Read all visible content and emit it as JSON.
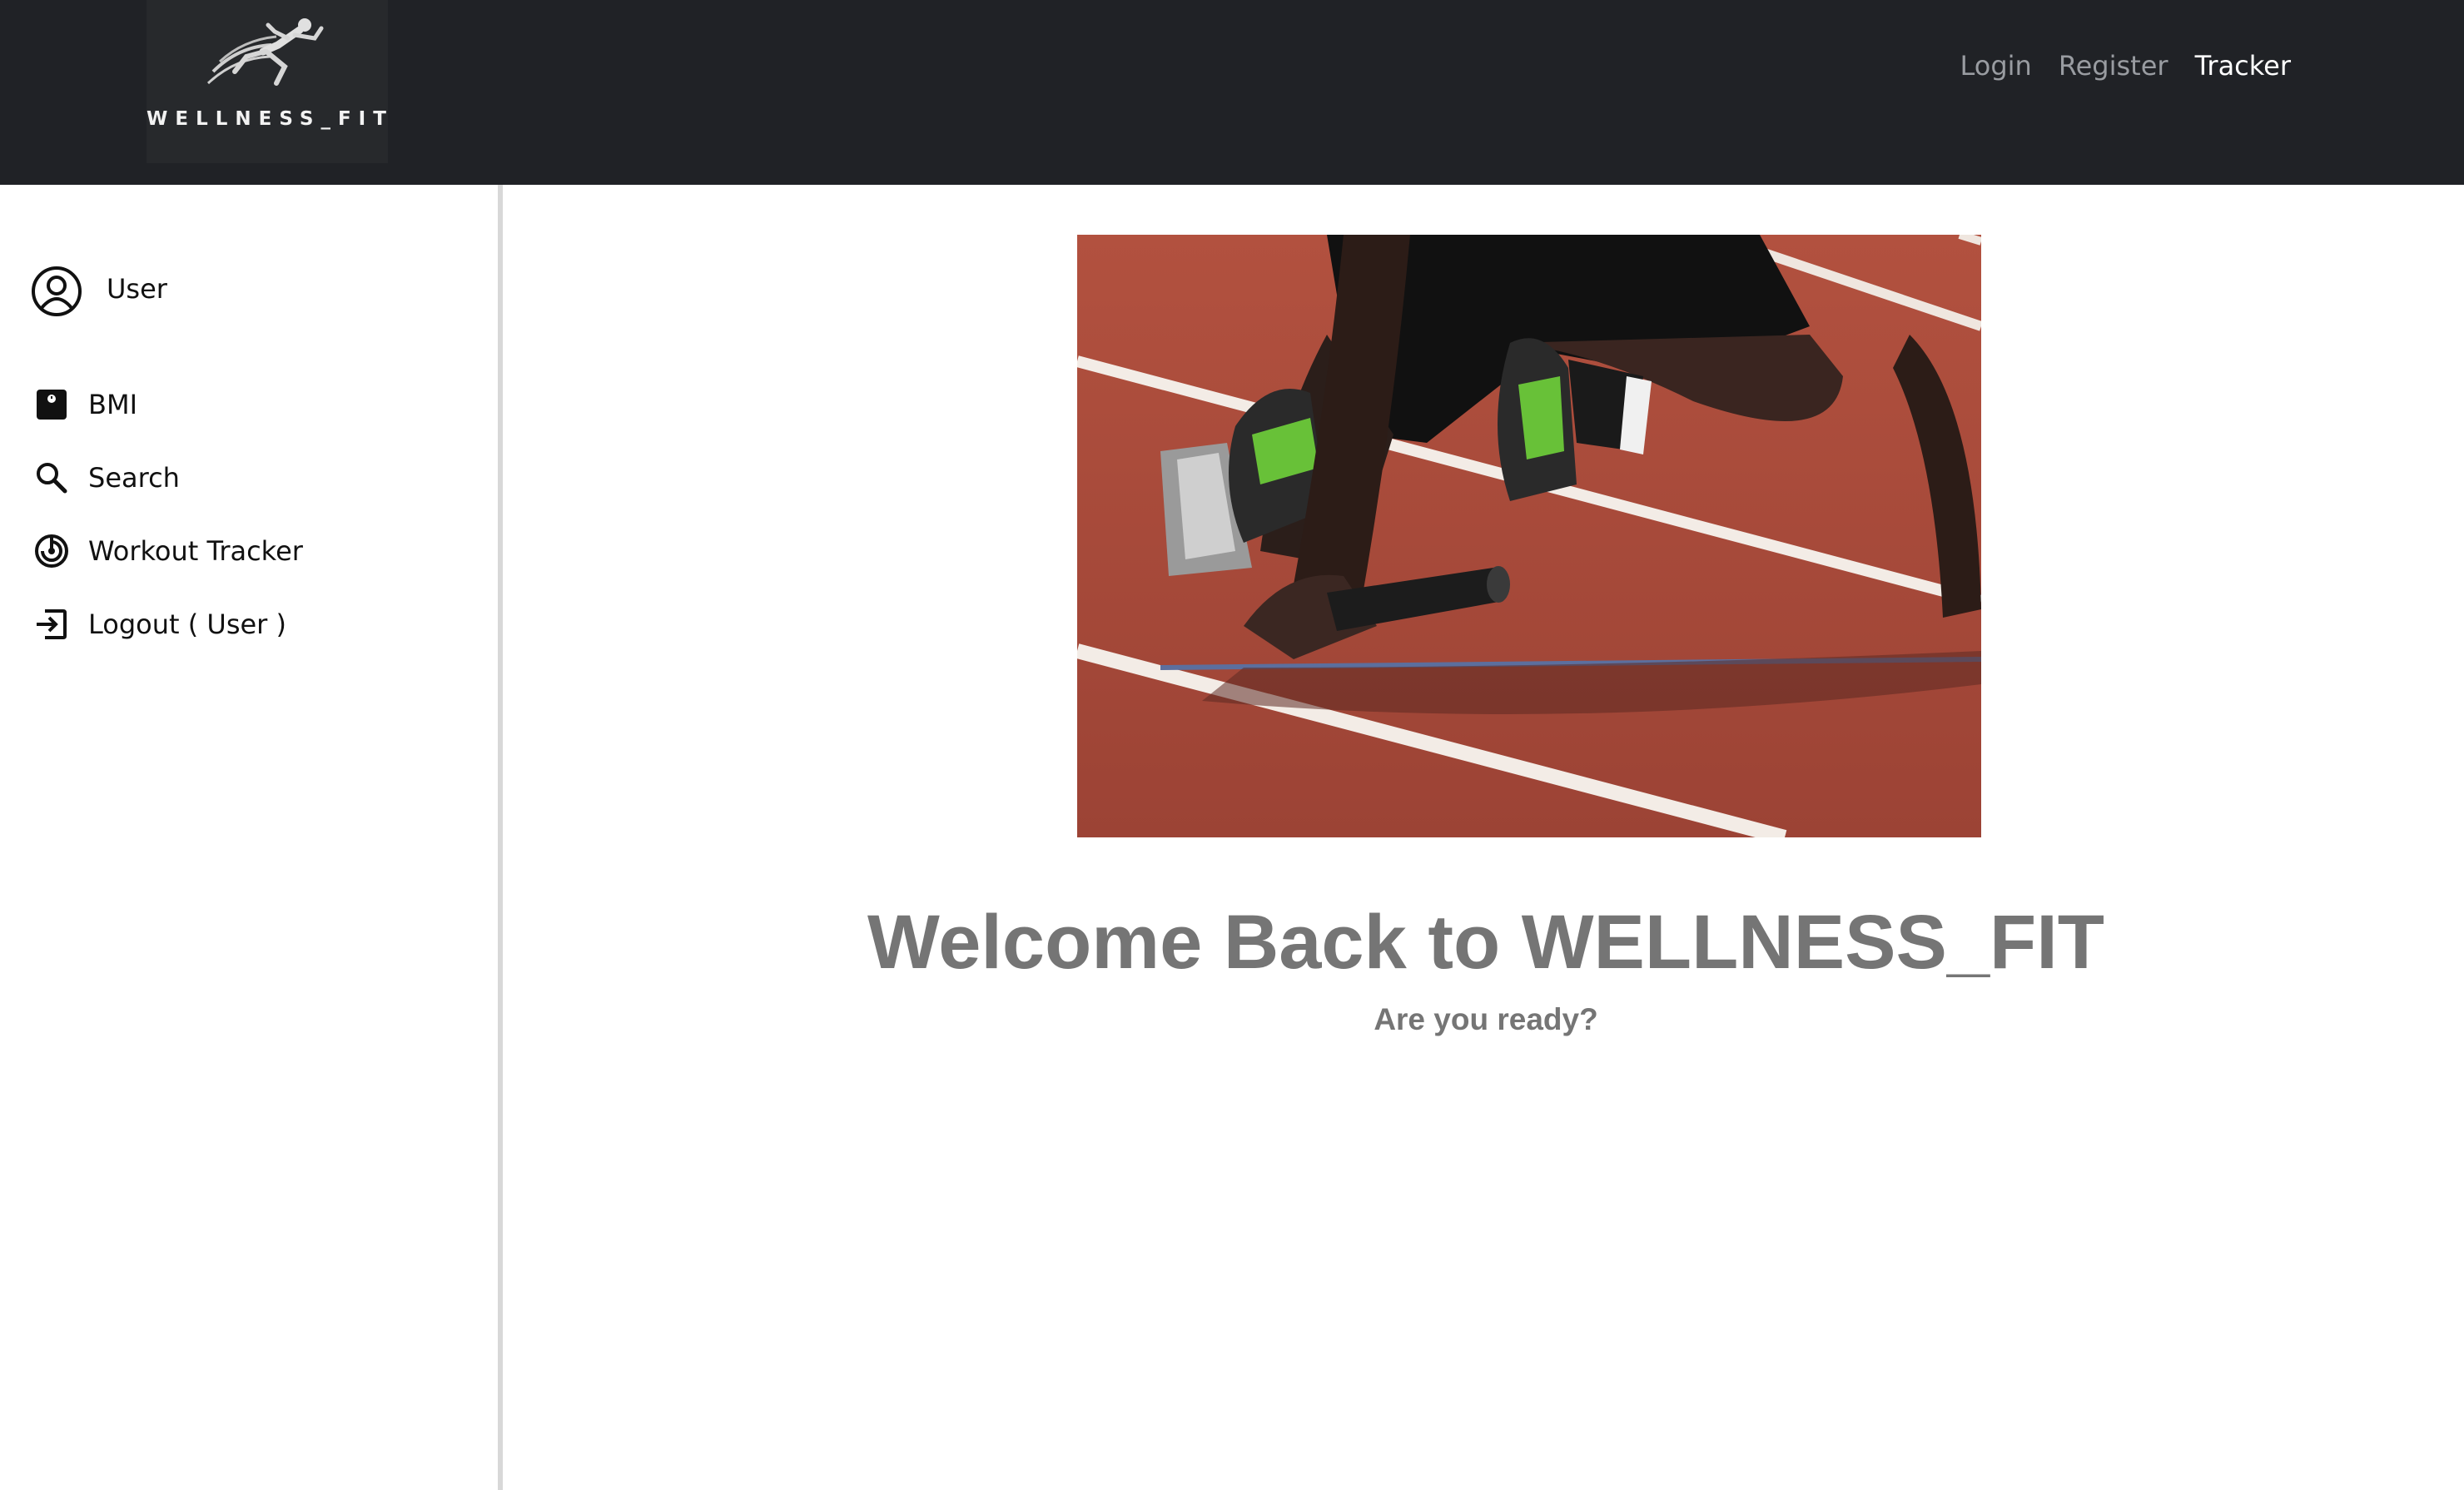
{
  "brand": {
    "logo_text": "WELLNESS_FIT",
    "logo_icon": "runner-icon"
  },
  "nav": {
    "links": [
      {
        "label": "Login",
        "active": false
      },
      {
        "label": "Register",
        "active": false
      },
      {
        "label": "Tracker",
        "active": true
      }
    ]
  },
  "sidebar": {
    "user": {
      "label": "User",
      "icon": "user-circle-icon"
    },
    "items": [
      {
        "label": "BMI",
        "icon": "scale-icon"
      },
      {
        "label": "Search",
        "icon": "search-icon"
      },
      {
        "label": "Workout Tracker",
        "icon": "target-icon"
      },
      {
        "label": "Logout ( User )",
        "icon": "logout-icon"
      }
    ]
  },
  "main": {
    "hero_image": "sprinter-starting-blocks-photo",
    "welcome": "Welcome Back to WELLNESS_FIT",
    "subtitle": "Are you ready?"
  },
  "colors": {
    "navbar_bg": "#202226",
    "nav_link": "#999ca1",
    "nav_link_active": "#ffffff",
    "heading": "#757575",
    "track": "#a34638"
  }
}
